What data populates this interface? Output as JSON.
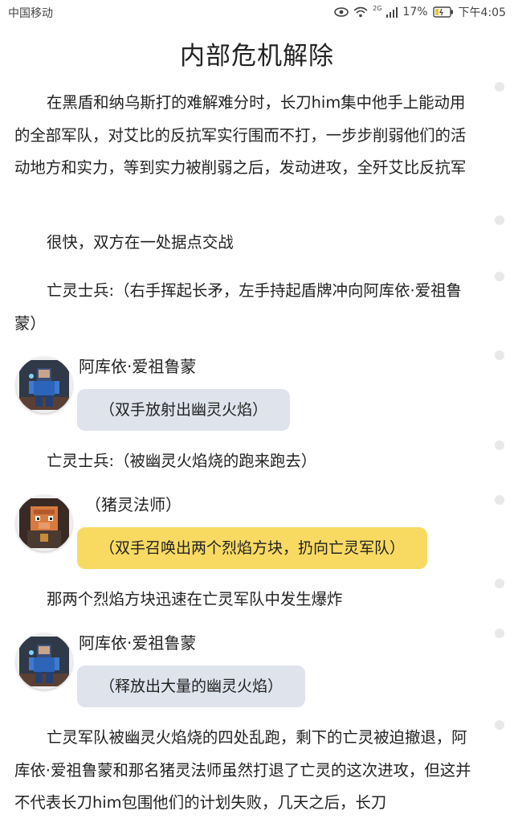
{
  "status_bar": {
    "carrier": "中国移动",
    "network": "2G",
    "battery": "17%",
    "time": "下午4:05"
  },
  "article": {
    "title": "内部危机解除",
    "paragraphs": [
      "在黑盾和纳乌斯打的难解难分时，长刀him集中他手上能动用的全部军队，对艾比的反抗军实行围而不打，一步步削弱他们的活动地方和实力，等到实力被削弱之后，发动进攻，全歼艾比反抗军",
      "很快，双方在一处据点交战",
      "亡灵士兵:（右手挥起长矛，左手持起盾牌冲向阿库依·爱祖鲁蒙）",
      "亡灵士兵:（被幽灵火焰烧的跑来跑去）",
      "那两个烈焰方块迅速在亡灵军队中发生爆炸",
      "亡灵军队被幽灵火焰烧的四处乱跑，剩下的亡灵被迫撤退，阿库依·爱祖鲁蒙和那名猪灵法师虽然打退了亡灵的这次进攻，但这并不代表长刀him包围他们的计划失败，几天之后，长刀"
    ],
    "messages": [
      {
        "speaker": "阿库依·爱祖鲁蒙",
        "text": "（双手放射出幽灵火焰）",
        "bubble_color": "#dfe3ec",
        "avatar_icon": "blue-armored-warrior-avatar"
      },
      {
        "speaker": "（猪灵法师）",
        "text": "（双手召唤出两个烈焰方块，扔向亡灵军队）",
        "bubble_color": "#f8da63",
        "avatar_icon": "piglin-mage-avatar"
      },
      {
        "speaker": "阿库依·爱祖鲁蒙",
        "text": "（释放出大量的幽灵火焰）",
        "bubble_color": "#dfe3ec",
        "avatar_icon": "blue-armored-warrior-avatar"
      }
    ]
  }
}
